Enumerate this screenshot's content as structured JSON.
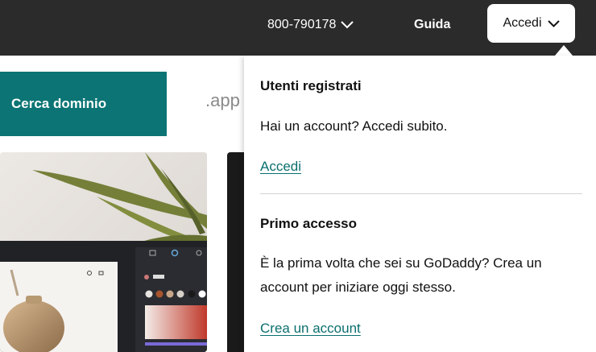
{
  "header": {
    "phone": "800-790178",
    "help_label": "Guida",
    "signin_label": "Accedi"
  },
  "page": {
    "search_button": "Cerca dominio",
    "tld_hint": ".app"
  },
  "dropdown": {
    "registered": {
      "title": "Utenti registrati",
      "text": "Hai un account? Accedi subito.",
      "link": "Accedi"
    },
    "first_access": {
      "title": "Primo accesso",
      "text": "È la prima volta che sei su GoDaddy? Crea un account per iniziare oggi stesso.",
      "link": "Crea un account"
    }
  },
  "colors": {
    "header_bg": "#2b2b2b",
    "accent_teal": "#0c7474",
    "link_teal": "#0b6f6f"
  }
}
